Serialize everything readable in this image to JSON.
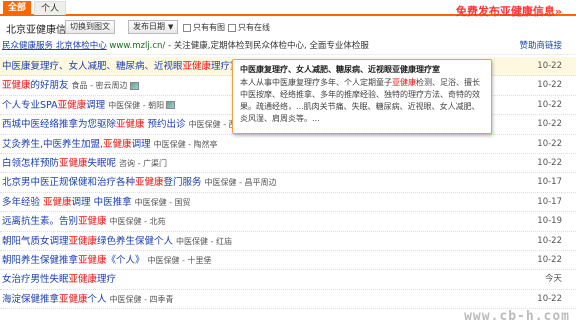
{
  "tabs": {
    "all": "全部",
    "personal": "个人"
  },
  "promo": "免费发布亚健康信息»",
  "toolbar": {
    "title": "北京亚健康信息",
    "switch_label": "切换到图文",
    "date_label": "发布日期",
    "date_arrow": "▼",
    "only_images": "只有有图",
    "only_online": "只有在线"
  },
  "sponsor": {
    "name": "民众健康服务 北京体检中心",
    "url": "www.mzlj.cn/",
    "desc": " - 关注健康,定期体检到民众体检中心, 全面专业体检服",
    "right": "赞助商链接"
  },
  "rows": [
    {
      "pre": "中医康复理疗、女人减肥、糖尿病、近视眼",
      "hl": "亚健康",
      "post": "理疗室",
      "meta": "",
      "pic": false,
      "date": "10-22"
    },
    {
      "pre": "",
      "hl": "亚健康",
      "post": "的好朋友",
      "meta": "食品 - 密云周边",
      "pic": true,
      "date": "10-22"
    },
    {
      "pre": "个人专业SPA",
      "hl": "亚健康",
      "post": "调理",
      "meta": "中医保健 - 朝阳",
      "pic": true,
      "date": "10-22"
    },
    {
      "pre": "西城中医经络推拿为您驱除",
      "hl": "亚健康",
      "post": " 预约出诊",
      "meta": "中医保健 - 西单",
      "pic": true,
      "date": "10-22"
    },
    {
      "pre": "艾灸养生,中医养生加盟,",
      "hl": "亚健康",
      "post": "调理",
      "meta": "中医保健 - 陶然亭",
      "pic": false,
      "date": "10-22"
    },
    {
      "pre": "白领怎样预防",
      "hl": "亚健康",
      "post": "失眠呢",
      "meta": "咨询 - 广渠门",
      "pic": false,
      "date": "10-22"
    },
    {
      "pre": "北京男中医正规保健和治疗各种",
      "hl": "亚健康",
      "post": "登门服务",
      "meta": "中医保健 - 昌平周边",
      "pic": false,
      "date": "10-17"
    },
    {
      "pre": "多年经验 ",
      "hl": "亚健康",
      "post": "调理 中医推拿",
      "meta": "中医保健 - 国贸",
      "pic": false,
      "date": "10-17"
    },
    {
      "pre": "远离抗生素。告别",
      "hl": "亚健康",
      "post": "",
      "meta": "中医保健 - 北苑",
      "pic": false,
      "date": "10-19"
    },
    {
      "pre": "朝阳气质女调理",
      "hl": "亚健康",
      "post": "绿色养生保健个人",
      "meta": "中医保健 - 红庙",
      "pic": false,
      "date": "10-22"
    },
    {
      "pre": "朝阳养生保健推拿",
      "hl": "亚健康",
      "post": "《个人》",
      "meta": "中医保健 - 十里堡",
      "pic": false,
      "date": "10-22"
    },
    {
      "pre": "女治疗男性失眠",
      "hl": "亚健康",
      "post": "理疗",
      "meta": "",
      "pic": false,
      "date": "今天"
    },
    {
      "pre": "海淀保健推拿",
      "hl": "亚健康",
      "post": "个人",
      "meta": "中医保健 - 四季青",
      "pic": false,
      "date": "10-22"
    }
  ],
  "popup": {
    "title": "中医康复理疗、女人减肥、糖尿病、近视眼亚健康理疗室",
    "body_pre": "本人从事中医康复理疗多年、个人定期童子",
    "body_hl": "亚健康",
    "body_post": "检测、足浴、擅长中医按摩、经络推拿、多年的推摩经验、独特的理疗方法、奇特的效果。疏通经络，...肌肉关节痛、失眠、糖尿病、近视眼、女人减肥、炎风湿、肩周炎等。..."
  },
  "watermark": "www.cb-h.com"
}
